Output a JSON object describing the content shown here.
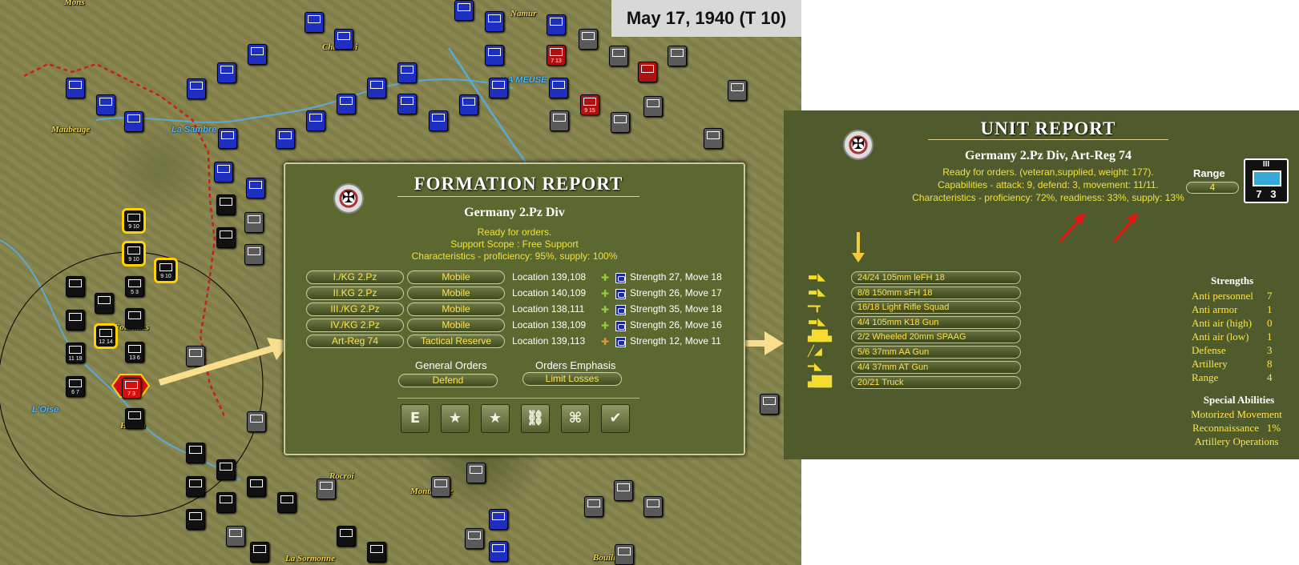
{
  "date_label": "May 17, 1940 (T 10)",
  "map": {
    "towns": [
      "Mons",
      "Namur",
      "Charleroi",
      "Maubeuge",
      "Fourmies",
      "Hirson",
      "Rocroi",
      "Montherme",
      "Bouillon",
      "La Sormonne"
    ],
    "rivers": [
      "LA MEUSE",
      "La Sambre",
      "L'Oise"
    ],
    "counter_labels": [
      "9 10",
      "9 10",
      "9 10",
      "7 3",
      "5 3",
      "12 14",
      "13 6",
      "11 19",
      "6 7",
      "7 13",
      "9 15"
    ]
  },
  "formation_report": {
    "title": "FORMATION REPORT",
    "subtitle": "Germany 2.Pz Div",
    "status": "Ready for orders.",
    "support": "Support Scope :  Free Support",
    "characteristics": "Characteristics - proficiency: 95%, supply: 100%",
    "units": [
      {
        "name": "I./KG 2.Pz",
        "mode": "Mobile",
        "location": "Location 139,108",
        "stats": "Strength 27, Move 18"
      },
      {
        "name": "II.KG 2.Pz",
        "mode": "Mobile",
        "location": "Location 140,109",
        "stats": "Strength 26, Move 17"
      },
      {
        "name": "III./KG 2.Pz",
        "mode": "Mobile",
        "location": "Location 138,111",
        "stats": "Strength 35, Move 18"
      },
      {
        "name": "IV./KG 2.Pz",
        "mode": "Mobile",
        "location": "Location 138,109",
        "stats": "Strength 26, Move 16"
      },
      {
        "name": "Art-Reg 74",
        "mode": "Tactical Reserve",
        "location": "Location 139,113",
        "stats": "Strength 12, Move 11"
      }
    ],
    "general_orders_label": "General Orders",
    "general_orders_value": "Defend",
    "orders_emphasis_label": "Orders Emphasis",
    "orders_emphasis_value": "Limit Losses",
    "buttons": [
      {
        "icon": "E-cycle-icon",
        "glyph": "E"
      },
      {
        "icon": "star-left-icon",
        "glyph": "★"
      },
      {
        "icon": "star-right-icon",
        "glyph": "★"
      },
      {
        "icon": "org-chart-icon",
        "glyph": "⛓"
      },
      {
        "icon": "org-chart-2-icon",
        "glyph": "⌘"
      },
      {
        "icon": "check-icon",
        "glyph": "✔"
      }
    ]
  },
  "unit_report": {
    "title": "UNIT REPORT",
    "subtitle": "Germany 2.Pz Div, Art-Reg 74",
    "line1": "Ready for orders. (veteran,supplied, weight: 177).",
    "line2": "Capabilities - attack: 9, defend: 3, movement: 11/11.",
    "line3": "Characteristics - proficiency: 72%, readiness: 33%, supply: 13%",
    "range_label": "Range",
    "range_value": "4",
    "counter_numbers": "7   3",
    "counter_top": "III",
    "equipment": [
      {
        "icon": "howitzer-icon",
        "label": "24/24 105mm leFH 18"
      },
      {
        "icon": "heavy-howitzer-icon",
        "label": "8/8 150mm sFH 18"
      },
      {
        "icon": "rifle-icon",
        "label": "16/18 Light Rifle Squad"
      },
      {
        "icon": "gun-icon",
        "label": "4/4 105mm K18 Gun"
      },
      {
        "icon": "spaag-icon",
        "label": "2/2 Wheeled 20mm SPAAG"
      },
      {
        "icon": "aa-gun-icon",
        "label": "5/6 37mm AA Gun"
      },
      {
        "icon": "at-gun-icon",
        "label": "4/4 37mm AT Gun"
      },
      {
        "icon": "truck-icon",
        "label": "20/21 Truck"
      }
    ],
    "strengths_title": "Strengths",
    "strengths": [
      {
        "label": "Anti personnel",
        "value": "7"
      },
      {
        "label": "Anti armor",
        "value": "1"
      },
      {
        "label": "Anti air (high)",
        "value": "0"
      },
      {
        "label": "Anti air (low)",
        "value": "1"
      },
      {
        "label": "Defense",
        "value": "3"
      },
      {
        "label": "Artillery",
        "value": "8"
      },
      {
        "label": "Range",
        "value": "4"
      }
    ],
    "special_title": "Special Abilities",
    "special": [
      "Motorized Movement",
      "Reconnaissance   1%",
      "Artillery Operations"
    ]
  }
}
